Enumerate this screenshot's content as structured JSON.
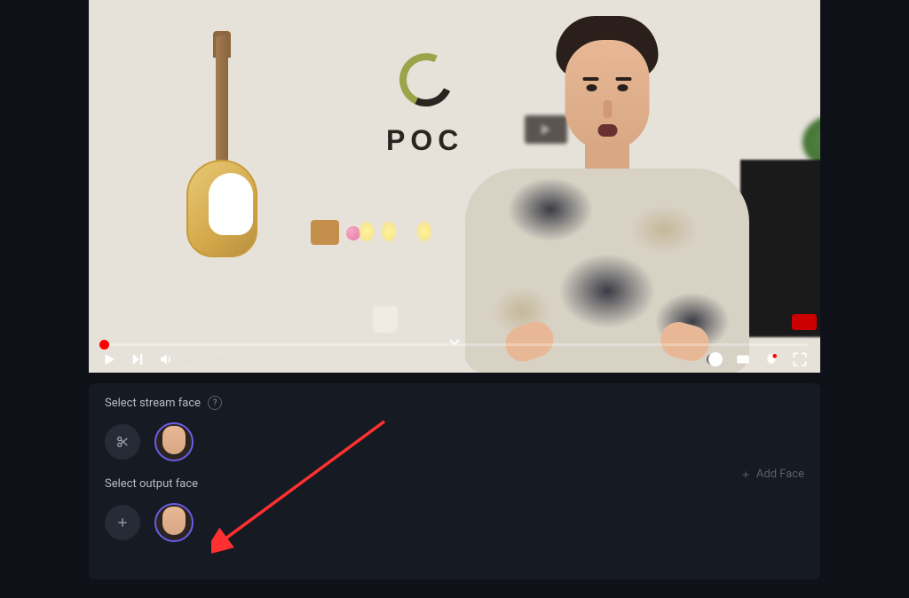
{
  "video": {
    "current_time": "0:02",
    "duration": "9:32",
    "time_display": "0:02 / 9:32",
    "poc_text": "POC"
  },
  "panel": {
    "stream_label": "Select stream face",
    "output_label": "Select output face",
    "help_mark": "?",
    "add_face_label": "Add Face"
  },
  "icons": {
    "plus": "+",
    "scissors": "scissors"
  }
}
